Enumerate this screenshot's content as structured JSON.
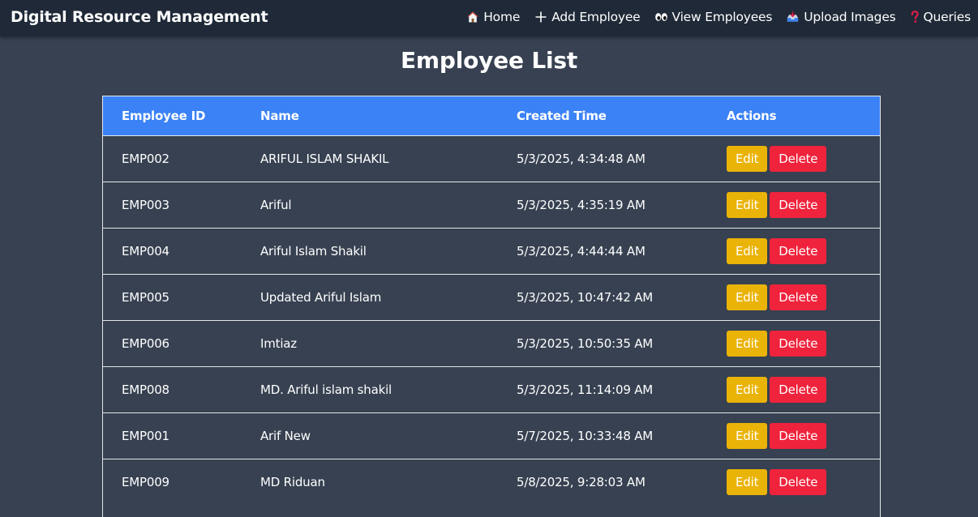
{
  "app": {
    "title": "Digital Resource Management"
  },
  "nav": [
    {
      "label": "Home",
      "icon": "house-icon"
    },
    {
      "label": "Add Employee",
      "icon": "plus-icon"
    },
    {
      "label": "View Employees",
      "icon": "eyes-icon"
    },
    {
      "label": "Upload Images",
      "icon": "inbox-tray-icon"
    },
    {
      "label": "Queries",
      "icon": "question-mark-icon"
    }
  ],
  "page": {
    "title": "Employee List"
  },
  "table": {
    "headers": {
      "id": "Employee ID",
      "name": "Name",
      "created": "Created Time",
      "actions": "Actions"
    },
    "edit_label": "Edit",
    "delete_label": "Delete",
    "rows": [
      {
        "id": "EMP002",
        "name": "ARIFUL ISLAM SHAKIL",
        "created": "5/3/2025, 4:34:48 AM"
      },
      {
        "id": "EMP003",
        "name": "Ariful",
        "created": "5/3/2025, 4:35:19 AM"
      },
      {
        "id": "EMP004",
        "name": "Ariful Islam Shakil",
        "created": "5/3/2025, 4:44:44 AM"
      },
      {
        "id": "EMP005",
        "name": "Updated Ariful Islam",
        "created": "5/3/2025, 10:47:42 AM"
      },
      {
        "id": "EMP006",
        "name": "Imtiaz",
        "created": "5/3/2025, 10:50:35 AM"
      },
      {
        "id": "EMP008",
        "name": "MD. Ariful islam shakil",
        "created": "5/3/2025, 11:14:09 AM"
      },
      {
        "id": "EMP001",
        "name": "Arif New",
        "created": "5/7/2025, 10:33:48 AM"
      },
      {
        "id": "EMP009",
        "name": "MD Riduan",
        "created": "5/8/2025, 9:28:03 AM"
      }
    ]
  },
  "colors": {
    "background": "#374151",
    "navbar": "#1f2937",
    "header": "#3b82f6",
    "edit": "#eab308",
    "delete": "#ef233c"
  }
}
